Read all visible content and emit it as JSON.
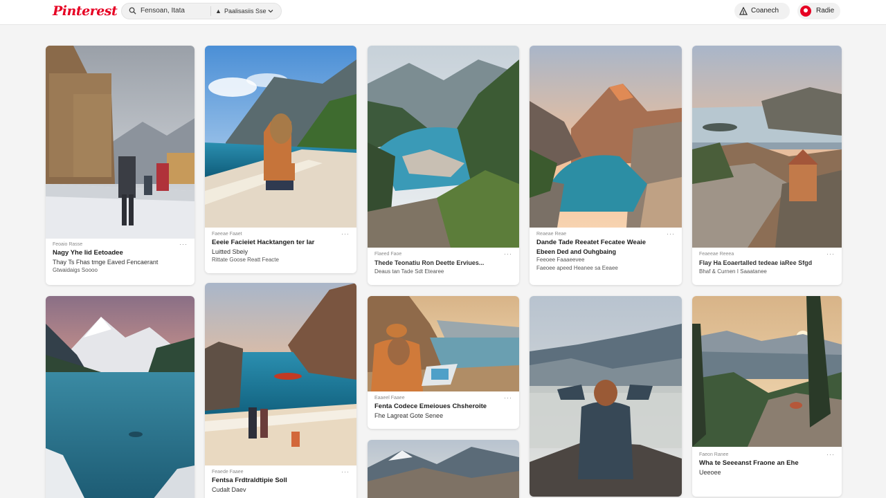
{
  "app": {
    "logo": "Pinterest"
  },
  "search": {
    "query": "Fensoan, Itata",
    "filter_label": "Paalisasiis Sse"
  },
  "header": {
    "connect_label": "Coanech",
    "profile_label": "Radie"
  },
  "colors": {
    "brand": "#e60023",
    "background": "#f4f4f4",
    "card": "#ffffff"
  },
  "icons": [
    "search-icon",
    "filter-icon",
    "chevron-down-icon",
    "connect-icon",
    "avatar",
    "more-dots-icon"
  ],
  "pins": [
    {
      "source": "Feoaio Rasse",
      "title": "Nagy Yhe Iid Eetoadee",
      "desc": "Thay Ts Fhas tmge Eaved Fencaerant",
      "sub": "Gtwaidaigs Soooo",
      "more": "···"
    },
    {
      "source": "Faeeae Faaet",
      "title": "Eeeie Facieiet Hacktangen ter Iar",
      "desc": "Luitted Sbeiy",
      "sub": "Rittate Goose Reatt Feacte",
      "more": "···"
    },
    {
      "source": "Flaeed Faoe",
      "title": "",
      "desc": "Thede Teonatiu Ron Deette Erviues...",
      "sub": "Deaus tan Tade Sdt Etearee",
      "more": "···"
    },
    {
      "source": "Reaeae Reae",
      "title": "Dande Tade Reeatet Fecatee Weaie",
      "desc": "Ebeen Ded and Ouhgbaing",
      "sub": "Feeoee Faaaeevee",
      "sub2": "Faeoee apeed Heanee sa Eeaee",
      "more": "···"
    },
    {
      "source": "Feaeeae Reeea",
      "title": "",
      "desc": "Flay Ha Eoaertalled tedeae iaRee Sfgd",
      "sub": "Bhaf & Curnen I Saaatanee",
      "more": "···"
    },
    {
      "source": "",
      "title": "",
      "desc": "",
      "sub": ""
    },
    {
      "source": "Feaede Faaee",
      "title": "Fentsa Frdtraldtipie Soll",
      "desc": "Cudalt Daev",
      "sub": "",
      "more": "···"
    },
    {
      "source": "Eaaeel Faaee",
      "title": "Fenta Codece Emeioues Chsheroite",
      "desc": "Fhe Lagreat Gote Senee",
      "sub": "",
      "more": "···"
    },
    {
      "source": "",
      "title": "",
      "desc": "",
      "sub": ""
    },
    {
      "source": "",
      "title": "",
      "desc": "",
      "sub": ""
    },
    {
      "source": "Faeon Ranee",
      "title": "Wha te Seeeanst Fraone an Ehe",
      "desc": "Ueeoee",
      "sub": "",
      "more": "···"
    }
  ]
}
